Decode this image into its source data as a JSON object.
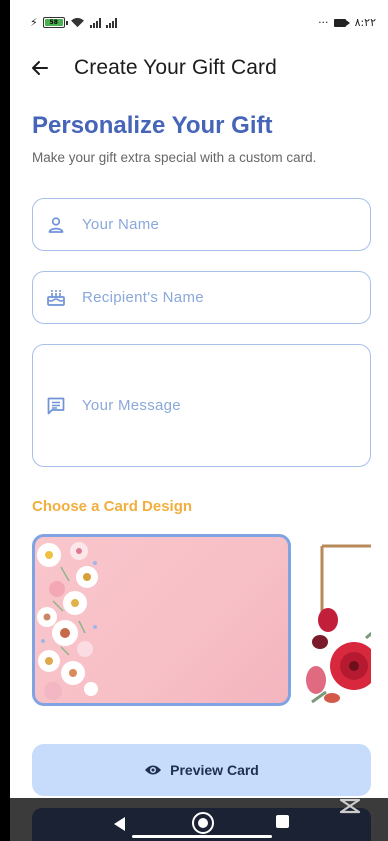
{
  "status_bar": {
    "battery_label": "58",
    "time": "٨:٢٢",
    "more": "···"
  },
  "app_bar": {
    "back_icon": "arrow-left-icon",
    "title": "Create Your Gift Card"
  },
  "header": {
    "title": "Personalize Your Gift",
    "subtitle": "Make your gift extra special with a custom card."
  },
  "form": {
    "name": {
      "icon": "person-icon",
      "placeholder": "Your Name"
    },
    "recipient": {
      "icon": "cake-icon",
      "placeholder": "Recipient's Name"
    },
    "message": {
      "icon": "message-icon",
      "placeholder": "Your Message"
    }
  },
  "designs": {
    "label": "Choose a Card Design",
    "items": [
      {
        "name": "pink-floral",
        "selected": true
      },
      {
        "name": "red-floral-frame",
        "selected": false
      }
    ]
  },
  "preview": {
    "icon": "eye-icon",
    "label": "Preview Card"
  },
  "colors": {
    "primary": "#4664b8",
    "accent": "#f2ae3e",
    "field_border": "#a7c0ea",
    "button_bg": "#c7dcfb"
  }
}
